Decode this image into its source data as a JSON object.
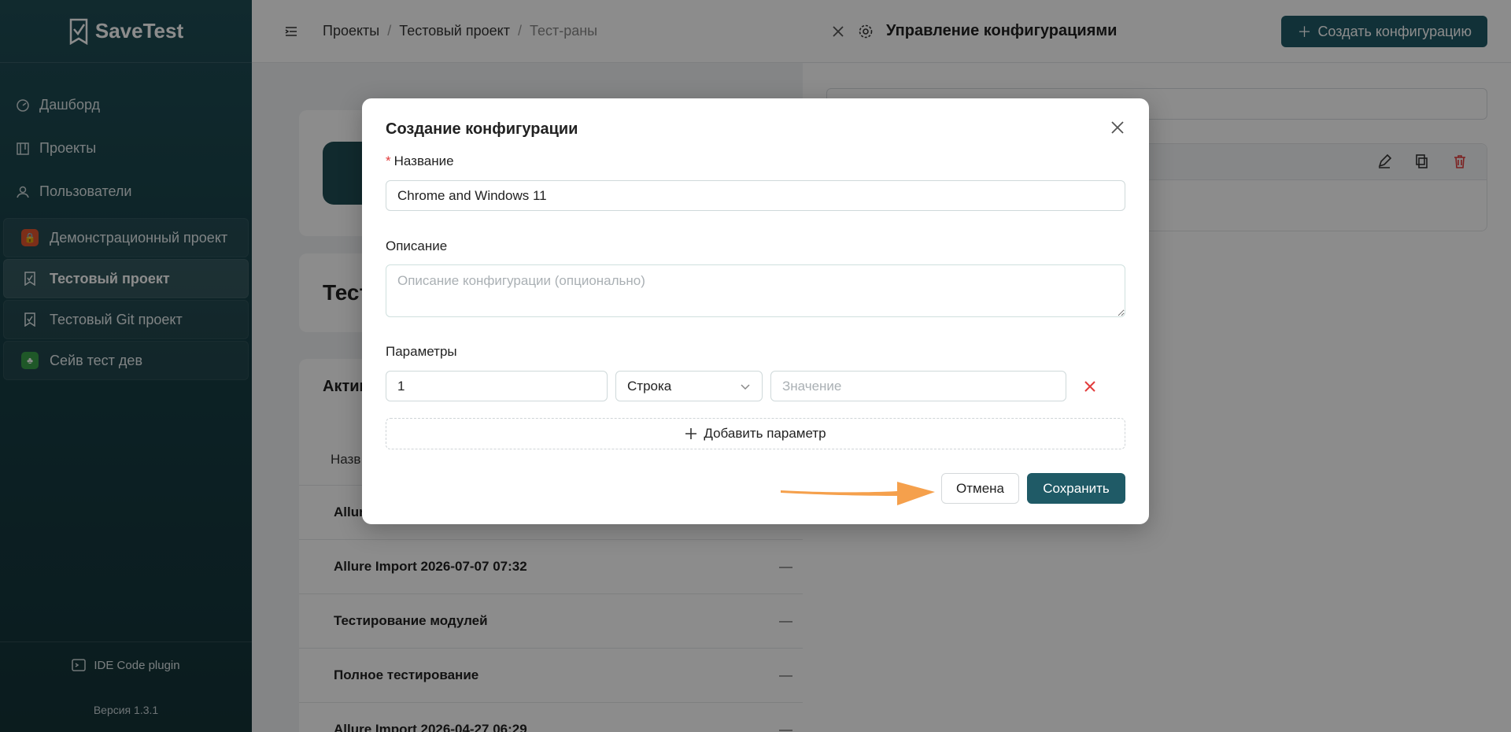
{
  "app": {
    "name": "SaveTest"
  },
  "sidebar": {
    "nav": [
      {
        "label": "Дашборд",
        "icon": "dashboard-icon"
      },
      {
        "label": "Проекты",
        "icon": "projects-icon"
      },
      {
        "label": "Пользователи",
        "icon": "users-icon"
      }
    ],
    "projects": [
      {
        "label": "Демонстрационный проект",
        "color": "#e2552f"
      },
      {
        "label": "Тестовый проект",
        "color": "#1f4d55"
      },
      {
        "label": "Тестовый Git проект",
        "color": "#1f4d55"
      },
      {
        "label": "Сейв тест дев",
        "color": "#3aa04a"
      }
    ],
    "plugin_label": "IDE Code plugin",
    "version": "Версия 1.3.1"
  },
  "breadcrumb": [
    "Проекты",
    "Тестовый проект",
    "Тест-раны"
  ],
  "main": {
    "title_partial": "Тест",
    "tab_partial": "Актив",
    "column_partial": "Назв",
    "rows": [
      {
        "name": "Allur",
        "value": ""
      },
      {
        "name": "Allure Import 2026-07-07 07:32",
        "value": "—"
      },
      {
        "name": "Тестирование модулей",
        "value": "—"
      },
      {
        "name": "Полное тестирование",
        "value": "—"
      },
      {
        "name": "Allure Import 2026-04-27 06:29",
        "value": "—"
      }
    ]
  },
  "panel": {
    "title": "Управление конфигурациями",
    "create_button": "Создать конфигурацию"
  },
  "modal": {
    "title": "Создание конфигурации",
    "name_label": "Название",
    "name_value": "Chrome and Windows 11",
    "description_label": "Описание",
    "description_placeholder": "Описание конфигурации (опционально)",
    "params_label": "Параметры",
    "param": {
      "key": "1",
      "type": "Строка",
      "value_placeholder": "Значение"
    },
    "add_param": "Добавить параметр",
    "cancel": "Отмена",
    "save": "Сохранить"
  },
  "colors": {
    "primary": "#1f5a66",
    "danger": "#e23c3c",
    "annotation_arrow": "#f5a04c"
  }
}
